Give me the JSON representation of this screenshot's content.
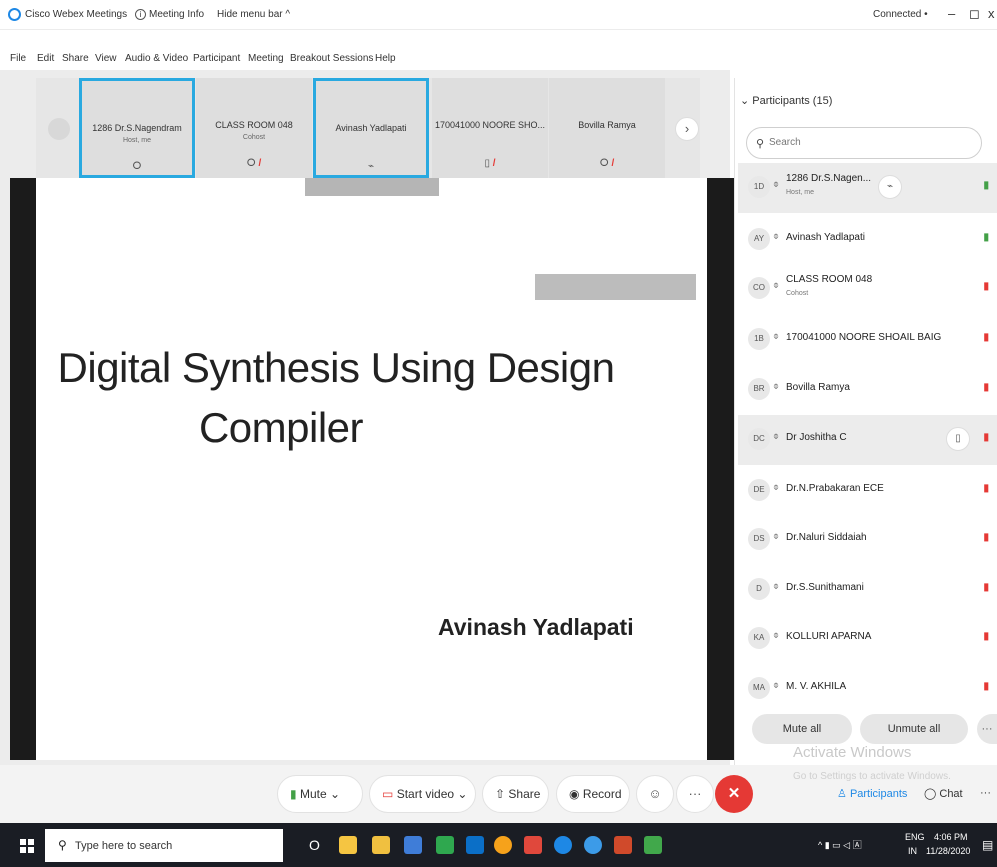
{
  "titlebar": {
    "app_name": "Cisco Webex Meetings",
    "meeting_info": "Meeting Info",
    "hide_menu": "Hide menu bar ^",
    "connection": "Connected •",
    "minimize": "–",
    "maximize": "◻",
    "close": "x"
  },
  "menu": [
    "File",
    "Edit",
    "Share",
    "View",
    "Audio & Video",
    "Participant",
    "Meeting",
    "Breakout Sessions",
    "Help"
  ],
  "video_strip": {
    "next_arrow": "›",
    "tiles": [
      {
        "name": "1286 Dr.S.Nagendram",
        "sub": "Host, me",
        "icons": "ⵔ"
      },
      {
        "name": "CLASS ROOM 048",
        "sub": "Cohost",
        "icons": "ⵔ"
      },
      {
        "name": "Avinash Yadlapati",
        "sub": "",
        "icons": "⌁"
      },
      {
        "name": "170041000 NOORE SHO...",
        "sub": "",
        "icons": "▯"
      },
      {
        "name": "Bovilla Ramya",
        "sub": "",
        "icons": "ⵔ"
      }
    ]
  },
  "slide": {
    "title_line1": "Digital Synthesis Using Design",
    "title_line2": "Compiler",
    "author": "Avinash Yadlapati"
  },
  "controls": {
    "mute": "Mute",
    "mute_caret": "⌄",
    "start_video": "Start video",
    "video_caret": "⌄",
    "share": "Share",
    "record": "Record",
    "reactions": "☺",
    "more": "···",
    "end": "✕"
  },
  "watermark": {
    "line1": "Activate Windows",
    "line2": "Go to Settings to activate Windows."
  },
  "panel": {
    "title": "⌄ Participants (15)",
    "search_placeholder": "Search",
    "tab_participants": "Participants",
    "tab_chat": "Chat",
    "tab_more": "···",
    "mute_all": "Mute all",
    "unmute_all": "Unmute all",
    "participants": [
      {
        "initials": "1D",
        "name": "1286 Dr.S.Nagen...",
        "role": "Host, me",
        "status_color": "#43a047"
      },
      {
        "initials": "AY",
        "name": "Avinash Yadlapati",
        "role": "",
        "status_color": "#43a047"
      },
      {
        "initials": "CO",
        "name": "CLASS ROOM 048",
        "role": "Cohost",
        "status_color": "#e53935"
      },
      {
        "initials": "1B",
        "name": "170041000 NOORE SHOAIL BAIG",
        "role": "",
        "status_color": "#e53935"
      },
      {
        "initials": "BR",
        "name": "Bovilla Ramya",
        "role": "",
        "status_color": "#e53935"
      },
      {
        "initials": "DC",
        "name": "Dr Joshitha C",
        "role": "",
        "status_color": "#e53935"
      },
      {
        "initials": "DE",
        "name": "Dr.N.Prabakaran ECE",
        "role": "",
        "status_color": "#e53935"
      },
      {
        "initials": "DS",
        "name": "Dr.Naluri Siddaiah",
        "role": "",
        "status_color": "#e53935"
      },
      {
        "initials": "D",
        "name": "Dr.S.Sunithamani",
        "role": "",
        "status_color": "#e53935"
      },
      {
        "initials": "KA",
        "name": "KOLLURI APARNA",
        "role": "",
        "status_color": "#e53935"
      },
      {
        "initials": "MA",
        "name": "M. V. AKHILA",
        "role": "",
        "status_color": "#e53935"
      }
    ]
  },
  "taskbar": {
    "search_placeholder": "Type here to search",
    "cortana": "O",
    "language": "ENG",
    "region": "IN",
    "time": "4:06 PM",
    "date": "11/28/2020"
  }
}
